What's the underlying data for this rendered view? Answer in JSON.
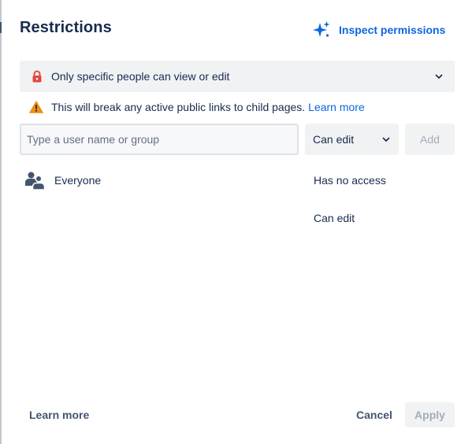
{
  "dialog": {
    "title": "Restrictions"
  },
  "inspect": {
    "label": "Inspect permissions",
    "icon": "sparkle-icon"
  },
  "restriction": {
    "selected": "Only specific people can view or edit",
    "icon": "lock-icon"
  },
  "warning": {
    "message": "This will break any active public links to child pages.",
    "link": "Learn more",
    "icon": "warning-icon"
  },
  "add_user": {
    "placeholder": "Type a user name or group",
    "value": "",
    "permission": "Can edit",
    "add_label": "Add"
  },
  "entries": [
    {
      "name": "Everyone",
      "icon": "group-icon"
    }
  ],
  "access_options": [
    "Has no access",
    "Can edit"
  ],
  "footer": {
    "learn_more": "Learn more",
    "cancel": "Cancel",
    "apply": "Apply"
  },
  "colors": {
    "link": "#0c66e4",
    "lock": "#e2483d",
    "warning": "#f18d13",
    "text": "#172b4d",
    "disabled_text": "#a5adba",
    "neutral_bg": "#f1f2f4"
  }
}
